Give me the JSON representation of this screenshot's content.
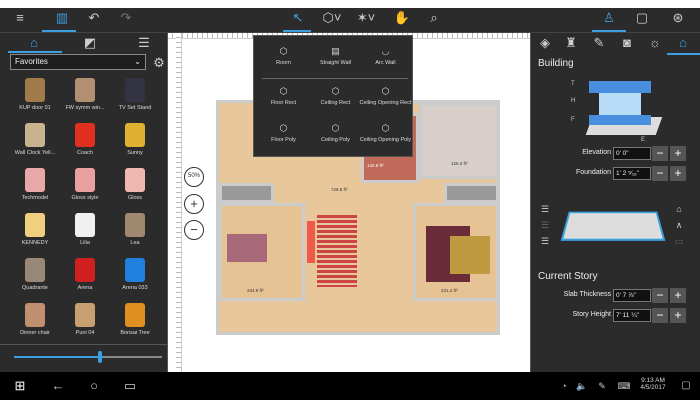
{
  "toolbar": {
    "icons": [
      "menu-icon",
      "library-icon",
      "undo-icon",
      "redo-icon",
      "select-icon",
      "3d-object-icon",
      "magic-icon",
      "pan-hand-icon",
      "search-icon",
      "person-icon",
      "plan-view-icon",
      "3d-view-icon"
    ]
  },
  "left": {
    "tabs": [
      "furniture",
      "materials",
      "list"
    ],
    "category": "Favorites",
    "items": [
      {
        "label": "KUP door 01",
        "color": "#a07a48"
      },
      {
        "label": "FW symm win...",
        "color": "#b09070"
      },
      {
        "label": "TV Set Stand",
        "color": "#334"
      },
      {
        "label": "Wall Clock Yell...",
        "color": "#c8b290"
      },
      {
        "label": "Coach",
        "color": "#e03020"
      },
      {
        "label": "Sunny",
        "color": "#e0b030"
      },
      {
        "label": "Techmodel",
        "color": "#e8a8a8"
      },
      {
        "label": "Gloss style",
        "color": "#e8a0a0"
      },
      {
        "label": "Gloss",
        "color": "#f0b8b0"
      },
      {
        "label": "KENNEDY",
        "color": "#f0d080"
      },
      {
        "label": "Lilia",
        "color": "#f0f0f0"
      },
      {
        "label": "Lea",
        "color": "#a08870"
      },
      {
        "label": "Quadrante",
        "color": "#998877"
      },
      {
        "label": "Arena",
        "color": "#d02020"
      },
      {
        "label": "Arena 033",
        "color": "#2080e0"
      },
      {
        "label": "Dinner chair",
        "color": "#c09070"
      },
      {
        "label": "Puni 04",
        "color": "#c8a070"
      },
      {
        "label": "Bonsai Tree",
        "color": "#e09020"
      }
    ],
    "slider_value": 0.6
  },
  "popup": {
    "items": [
      "Room",
      "Straight Wall",
      "Arc Wall",
      "Floor Rect",
      "Ceiling Rect",
      "Ceiling Opening Rect",
      "Floor Poly",
      "Ceiling Poly",
      "Ceiling Opening Poly"
    ]
  },
  "canvas": {
    "zoom": "50%",
    "areas": [
      "728.8 ft²",
      "142.8 ft²",
      "126.3 ft²",
      "234.9 ft²",
      "231.4 ft²"
    ]
  },
  "right": {
    "title": "Building",
    "diagram": {
      "t": "T",
      "h": "H",
      "f": "F",
      "e": "E"
    },
    "elevation_label": "Elevation",
    "elevation": "0' 0\"",
    "foundation_label": "Foundation",
    "foundation": "1' 2 ⁵⁄₁₆\"",
    "story_title": "Current Story",
    "slab_label": "Slab Thickness",
    "slab": "0' 7 ⅞\"",
    "height_label": "Story Height",
    "height": "7' 11 ¼\""
  },
  "taskbar": {
    "time": "9:13 AM",
    "date": "4/5/2017"
  }
}
